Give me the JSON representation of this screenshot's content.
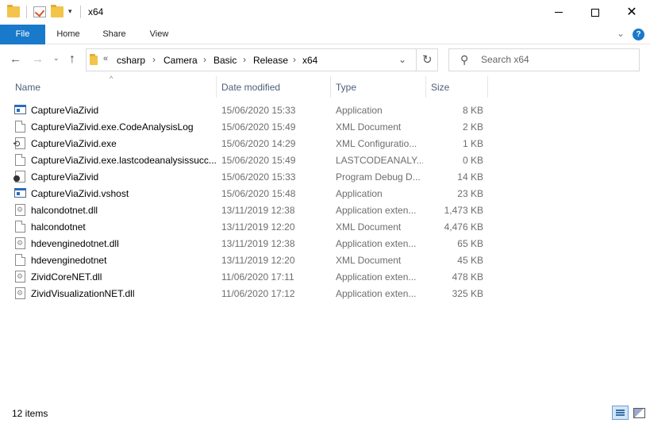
{
  "window": {
    "title": "x64",
    "qa_dropdown": "▾"
  },
  "ribbon": {
    "tabs": [
      {
        "label": "File"
      },
      {
        "label": "Home"
      },
      {
        "label": "Share"
      },
      {
        "label": "View"
      }
    ],
    "help": "?"
  },
  "address": {
    "overflow": "«",
    "crumbs": [
      "csharp",
      "Camera",
      "Basic",
      "Release",
      "x64"
    ]
  },
  "search": {
    "placeholder": "Search x64"
  },
  "columns": {
    "name": "Name",
    "date": "Date modified",
    "type": "Type",
    "size": "Size"
  },
  "files": [
    {
      "name": "CaptureViaZivid",
      "date": "15/06/2020 15:33",
      "type": "Application",
      "size": "8 KB",
      "icon": "app-icon"
    },
    {
      "name": "CaptureViaZivid.exe.CodeAnalysisLog",
      "date": "15/06/2020 15:49",
      "type": "XML Document",
      "size": "2 KB",
      "icon": "document-icon"
    },
    {
      "name": "CaptureViaZivid.exe",
      "date": "15/06/2020 14:29",
      "type": "XML Configuratio...",
      "size": "1 KB",
      "icon": "config-icon"
    },
    {
      "name": "CaptureViaZivid.exe.lastcodeanalysissucc...",
      "date": "15/06/2020 15:49",
      "type": "LASTCODEANALY...",
      "size": "0 KB",
      "icon": "document-icon"
    },
    {
      "name": "CaptureViaZivid",
      "date": "15/06/2020 15:33",
      "type": "Program Debug D...",
      "size": "14 KB",
      "icon": "debug-database-icon"
    },
    {
      "name": "CaptureViaZivid.vshost",
      "date": "15/06/2020 15:48",
      "type": "Application",
      "size": "23 KB",
      "icon": "app-icon"
    },
    {
      "name": "halcondotnet.dll",
      "date": "13/11/2019 12:38",
      "type": "Application exten...",
      "size": "1,473 KB",
      "icon": "dll-icon"
    },
    {
      "name": "halcondotnet",
      "date": "13/11/2019 12:20",
      "type": "XML Document",
      "size": "4,476 KB",
      "icon": "document-icon"
    },
    {
      "name": "hdevenginedotnet.dll",
      "date": "13/11/2019 12:38",
      "type": "Application exten...",
      "size": "65 KB",
      "icon": "dll-icon"
    },
    {
      "name": "hdevenginedotnet",
      "date": "13/11/2019 12:20",
      "type": "XML Document",
      "size": "45 KB",
      "icon": "document-icon"
    },
    {
      "name": "ZividCoreNET.dll",
      "date": "11/06/2020 17:11",
      "type": "Application exten...",
      "size": "478 KB",
      "icon": "dll-icon"
    },
    {
      "name": "ZividVisualizationNET.dll",
      "date": "11/06/2020 17:12",
      "type": "Application exten...",
      "size": "325 KB",
      "icon": "dll-icon"
    }
  ],
  "status": {
    "item_count": "12 items"
  },
  "colors": {
    "file_tab": "#1979ca",
    "header_text": "#4c607a",
    "secondary_text": "#6d6d6d"
  }
}
